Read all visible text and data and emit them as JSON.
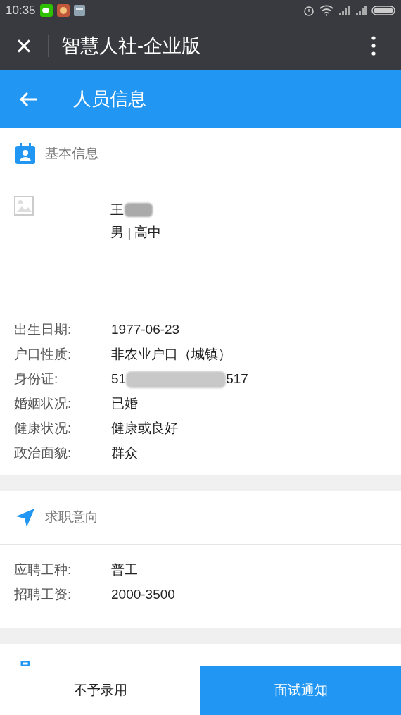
{
  "status_bar": {
    "time": "10:35"
  },
  "app_bar": {
    "close": "×",
    "title": "智慧人社-企业版"
  },
  "header": {
    "title": "人员信息"
  },
  "basic_info": {
    "title": "基本信息",
    "name": "王",
    "gender_education": "男 | 高中",
    "fields": [
      {
        "label": "出生日期:",
        "value": "1977-06-23"
      },
      {
        "label": "户口性质:",
        "value": "非农业户口（城镇）"
      },
      {
        "label": "身份证:",
        "value": "51",
        "value_end": "517",
        "kind": "masked"
      },
      {
        "label": "婚姻状况:",
        "value": "已婚"
      },
      {
        "label": "健康状况:",
        "value": "健康或良好"
      },
      {
        "label": "政治面貌:",
        "value": "群众"
      }
    ]
  },
  "job_intent": {
    "title": "求职意向",
    "fields": [
      {
        "label": "应聘工种:",
        "value": "普工"
      },
      {
        "label": "招聘工资:",
        "value": "2000-3500"
      }
    ]
  },
  "actions": [
    {
      "label": "不予录用",
      "kind": "secondary"
    },
    {
      "label": "面试通知",
      "kind": "primary"
    }
  ]
}
